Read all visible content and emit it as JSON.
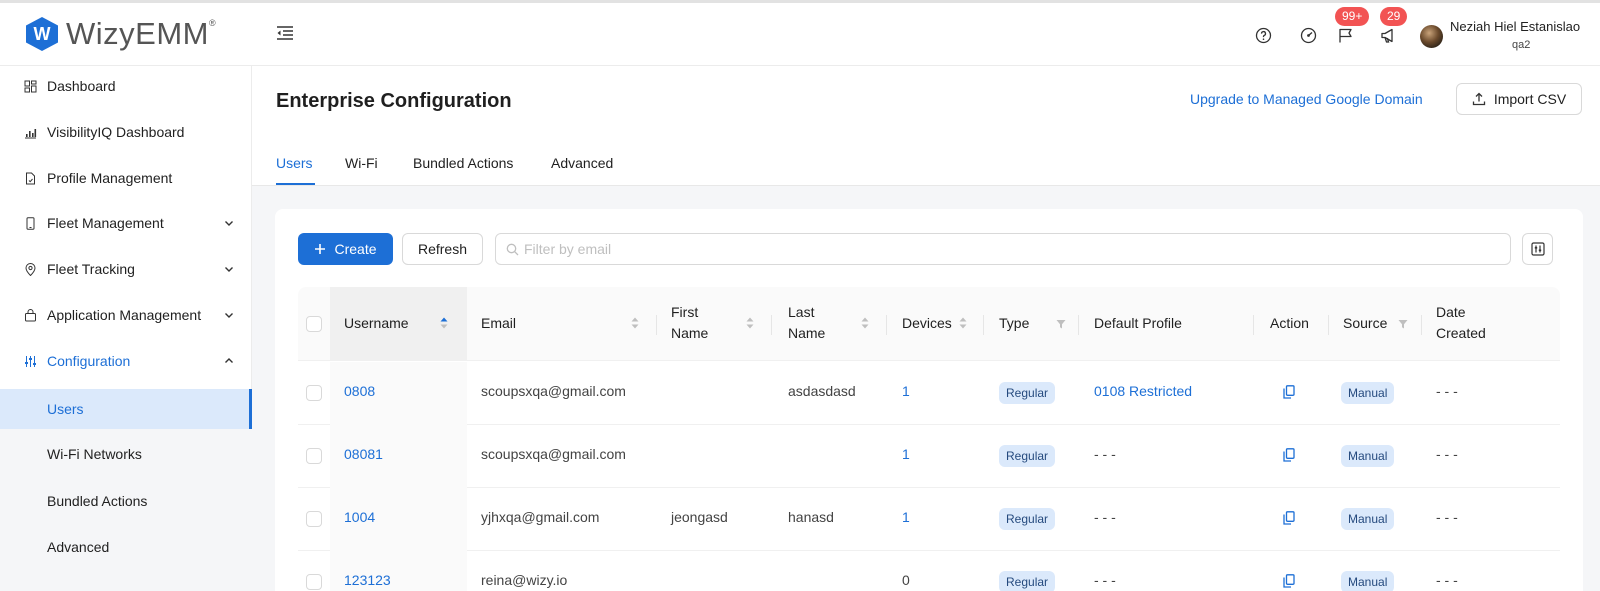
{
  "app": {
    "logo_text": "WizyEMM",
    "logo_mark": "W",
    "logo_reg": "®"
  },
  "header": {
    "notifications_count": "99+",
    "announcements_count": "29",
    "user_name": "Neziah Hiel Estanislao",
    "user_role": "qa2"
  },
  "sidebar": {
    "items": [
      {
        "label": "Dashboard",
        "icon": "dashboard-icon"
      },
      {
        "label": "VisibilityIQ Dashboard",
        "icon": "chart-icon"
      },
      {
        "label": "Profile Management",
        "icon": "file-icon"
      },
      {
        "label": "Fleet Management",
        "icon": "phone-icon"
      },
      {
        "label": "Fleet Tracking",
        "icon": "location-icon"
      },
      {
        "label": "Application Management",
        "icon": "bag-icon"
      },
      {
        "label": "Configuration",
        "icon": "sliders-icon"
      }
    ],
    "subitems": [
      {
        "label": "Users"
      },
      {
        "label": "Wi-Fi Networks"
      },
      {
        "label": "Bundled Actions"
      },
      {
        "label": "Advanced"
      }
    ]
  },
  "page": {
    "title": "Enterprise Configuration",
    "upgrade_link": "Upgrade to Managed Google Domain",
    "import_button": "Import CSV",
    "tabs": [
      "Users",
      "Wi-Fi",
      "Bundled Actions",
      "Advanced"
    ]
  },
  "toolbar": {
    "create_label": "Create",
    "refresh_label": "Refresh",
    "filter_placeholder": "Filter by email"
  },
  "table": {
    "columns": {
      "username": "Username",
      "email": "Email",
      "first_name": [
        "First",
        "Name"
      ],
      "last_name": [
        "Last",
        "Name"
      ],
      "devices": "Devices",
      "type": "Type",
      "default_profile": "Default Profile",
      "action": "Action",
      "source": "Source",
      "date_created": [
        "Date",
        "Created"
      ]
    },
    "rows": [
      {
        "username": "0808",
        "email": "scoupsxqa@gmail.com",
        "first_name": "",
        "last_name": "asdasdasd",
        "devices": "1",
        "type": "Regular",
        "default_profile": "0108 Restricted",
        "source": "Manual",
        "date_created": "- - -"
      },
      {
        "username": "08081",
        "email": "scoupsxqa@gmail.com",
        "first_name": "",
        "last_name": "",
        "devices": "1",
        "type": "Regular",
        "default_profile": "- - -",
        "source": "Manual",
        "date_created": "- - -"
      },
      {
        "username": "1004",
        "email": "yjhxqa@gmail.com",
        "first_name": "jeongasd",
        "last_name": "hanasd",
        "devices": "1",
        "type": "Regular",
        "default_profile": "- - -",
        "source": "Manual",
        "date_created": "- - -"
      },
      {
        "username": "123123",
        "email": "reina@wizy.io",
        "first_name": "",
        "last_name": "",
        "devices": "0",
        "type": "Regular",
        "default_profile": "- - -",
        "source": "Manual",
        "date_created": "- - -"
      }
    ]
  },
  "colors": {
    "accent": "#1d6fd6",
    "badge": "#f25353",
    "tag_bg": "#dbe9fb",
    "page_bg": "#f5f6f8"
  }
}
